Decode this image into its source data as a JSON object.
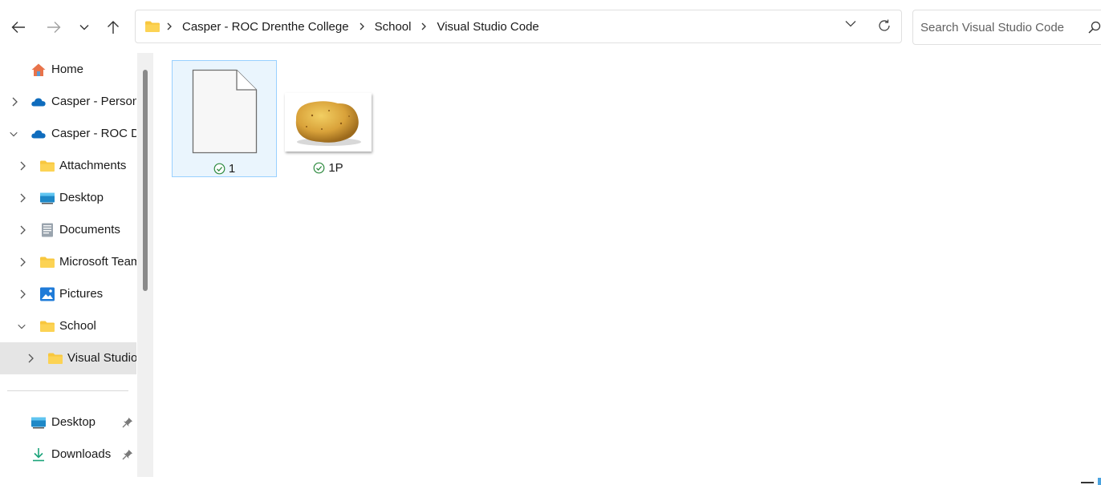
{
  "toolbar": {
    "breadcrumbs": [
      "Casper - ROC Drenthe College",
      "School",
      "Visual Studio Code"
    ],
    "search_placeholder": "Search Visual Studio Code"
  },
  "sidebar": {
    "items": [
      {
        "label": "Home"
      },
      {
        "label": "Casper - Personal"
      },
      {
        "label": "Casper - ROC Drenthe College"
      },
      {
        "label": "Attachments"
      },
      {
        "label": "Desktop"
      },
      {
        "label": "Documents"
      },
      {
        "label": "Microsoft Teams Chat Files"
      },
      {
        "label": "Pictures"
      },
      {
        "label": "School"
      },
      {
        "label": "Visual Studio Code"
      }
    ],
    "quick_access": [
      {
        "label": "Desktop"
      },
      {
        "label": "Downloads"
      }
    ]
  },
  "files": [
    {
      "name": "1",
      "sync_status": "synced",
      "icon": "blank-file-icon"
    },
    {
      "name": "1P",
      "sync_status": "synced",
      "icon": "potato-thumbnail"
    }
  ],
  "colors": {
    "folder_yellow": "#f8c73e",
    "onedrive_blue": "#0f6cbd",
    "sync_green": "#2d8a3e",
    "selection_blue": "#99d1ff"
  }
}
